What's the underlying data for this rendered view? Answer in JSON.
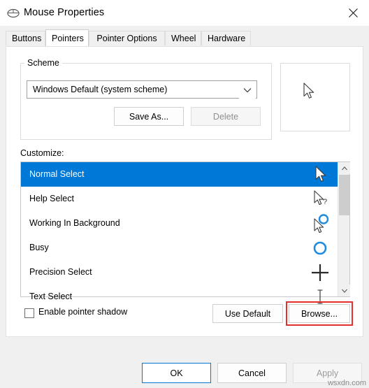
{
  "window": {
    "title": "Mouse Properties",
    "icon": "mouse-icon",
    "close_label": "✕"
  },
  "tabs": [
    {
      "label": "Buttons",
      "active": false
    },
    {
      "label": "Pointers",
      "active": true
    },
    {
      "label": "Pointer Options",
      "active": false
    },
    {
      "label": "Wheel",
      "active": false
    },
    {
      "label": "Hardware",
      "active": false
    }
  ],
  "scheme": {
    "group_title": "Scheme",
    "combo_value": "Windows Default (system scheme)",
    "save_as_label": "Save As...",
    "delete_label": "Delete"
  },
  "customize": {
    "label": "Customize:",
    "items": [
      {
        "label": "Normal Select",
        "cursor": "arrow",
        "selected": true
      },
      {
        "label": "Help Select",
        "cursor": "arrow-question",
        "selected": false
      },
      {
        "label": "Working In Background",
        "cursor": "arrow-ring",
        "selected": false
      },
      {
        "label": "Busy",
        "cursor": "ring",
        "selected": false
      },
      {
        "label": "Precision Select",
        "cursor": "crosshair",
        "selected": false
      },
      {
        "label": "Text Select",
        "cursor": "ibeam",
        "selected": false
      }
    ]
  },
  "options": {
    "shadow_label": "Enable pointer shadow",
    "shadow_checked": false,
    "use_default_label": "Use Default",
    "browse_label": "Browse..."
  },
  "dialog_buttons": {
    "ok": "OK",
    "cancel": "Cancel",
    "apply": "Apply"
  },
  "watermark": "wsxdn.com",
  "colors": {
    "accent": "#0078d7",
    "highlight_border": "#e0312f",
    "cursor_blue": "#1f8ce0"
  }
}
